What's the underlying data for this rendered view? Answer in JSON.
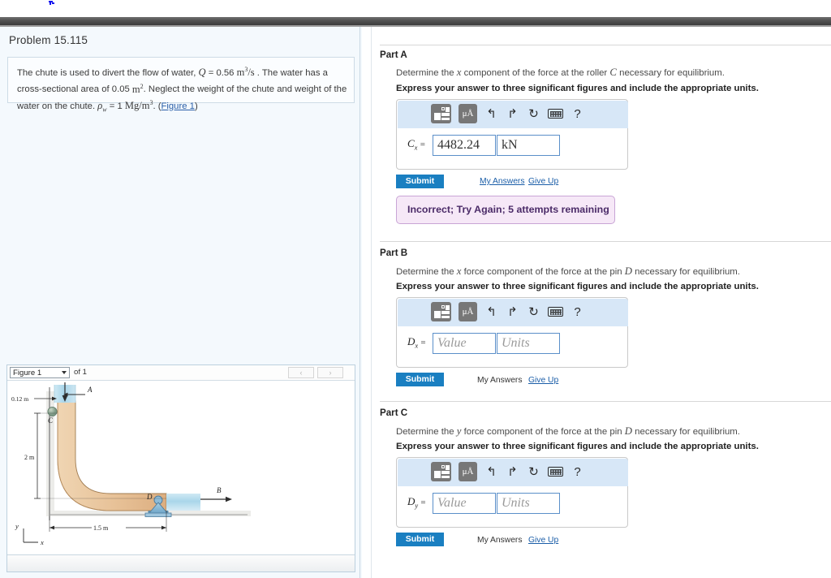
{
  "problem": {
    "title": "Problem 15.115",
    "statement_parts": {
      "t1": "The chute is used to divert the flow of water, ",
      "Q": "Q",
      "t2": " = 0.56 ",
      "u1": "m",
      "u1sup": "3",
      "u1b": "/s",
      "t3": " . The water has a cross-sectional area of 0.05 ",
      "u2": "m",
      "u2sup": "2",
      "t4": ". Neglect the weight of the chute and weight of the water on the chute. ",
      "rho": "ρ",
      "rhosub": "w",
      "t5": " = 1 ",
      "u3": "Mg/m",
      "u3sup": "3",
      "t6": ". (",
      "figure_link": "Figure 1",
      "t7": ")"
    }
  },
  "figure_panel": {
    "selected_figure": "Figure 1",
    "of_label": "of 1",
    "prev_label": "‹",
    "next_label": "›",
    "diagram": {
      "labels": {
        "dim_top": "0.12 m",
        "dim_left": "2 m",
        "dim_bottom": "1.5 m",
        "point_A": "A",
        "point_B": "B",
        "point_C": "C",
        "point_D": "D",
        "axis_y": "y",
        "axis_x": "x"
      },
      "colors": {
        "chute": "#e8c49a",
        "water": "#b7dcec",
        "support": "#7fb4d4",
        "ground": "#b9b9b9"
      }
    }
  },
  "toolbar": {
    "template_icon": "template-icon",
    "units_label": "μÅ",
    "undo_icon": "↰",
    "redo_icon": "↱",
    "reset_icon": "↻",
    "keyboard_icon": "keyboard-icon",
    "help_icon": "?"
  },
  "common": {
    "submit_label": "Submit",
    "my_answers_label": "My Answers",
    "give_up_label": "Give Up",
    "sig_figs_note": "Express your answer to three significant figures and include the appropriate units.",
    "value_placeholder": "Value",
    "units_placeholder": "Units"
  },
  "parts": [
    {
      "label": "Part A",
      "question_pre": "Determine the ",
      "question_var": "x",
      "question_mid": " component of the force at the roller ",
      "question_var2": "C",
      "question_post": " necessary for equilibrium.",
      "answer_label": "C",
      "answer_sub": "x",
      "equals": "=",
      "value": "4482.24",
      "units": "kN",
      "filled": true,
      "feedback": "Incorrect; Try Again; 5 attempts remaining"
    },
    {
      "label": "Part B",
      "question_pre": "Determine the ",
      "question_var": "x",
      "question_mid": " force component of the force at the pin ",
      "question_var2": "D",
      "question_post": " necessary for equilibrium.",
      "answer_label": "D",
      "answer_sub": "x",
      "equals": "=",
      "value": "",
      "units": "",
      "filled": false,
      "feedback": ""
    },
    {
      "label": "Part C",
      "question_pre": "Determine the ",
      "question_var": "y",
      "question_mid": " force component of the force at the pin ",
      "question_var2": "D",
      "question_post": " necessary for equilibrium.",
      "answer_label": "D",
      "answer_sub": "y",
      "equals": "=",
      "value": "",
      "units": "",
      "filled": false,
      "feedback": ""
    }
  ],
  "colors": {
    "accent_blue": "#1a7fc1",
    "link_blue": "#1b5ea8",
    "toolbar_blue": "#d7e7f7",
    "alert_bg": "#f6e8f7",
    "alert_border": "#c9a5d6",
    "alert_text": "#4b2b68",
    "panel_bg": "#f4f9fd"
  }
}
